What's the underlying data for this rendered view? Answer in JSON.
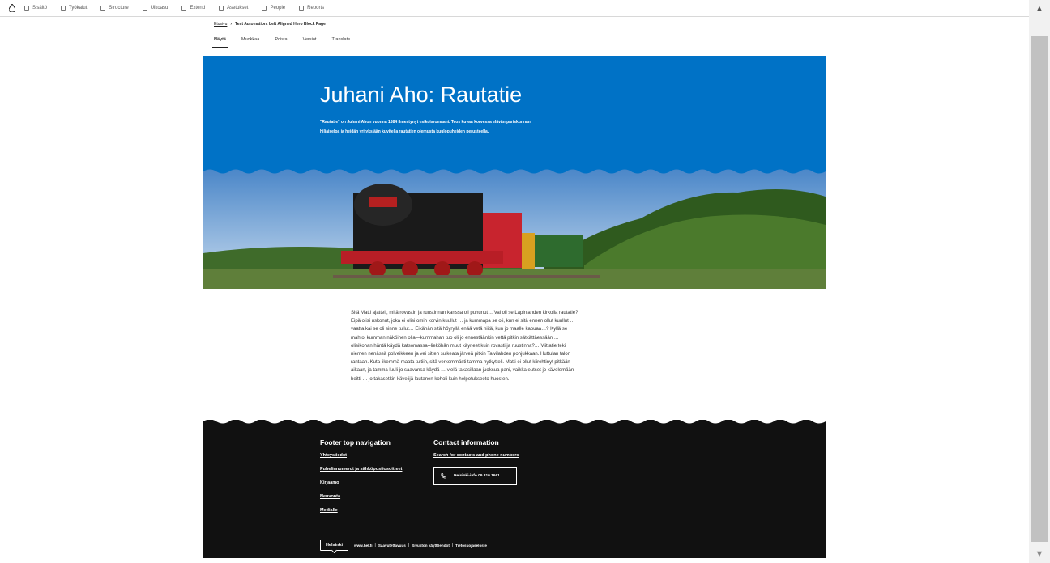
{
  "toolbar": {
    "items": [
      {
        "label": "Sisältö",
        "icon": "content-icon"
      },
      {
        "label": "Työkalut",
        "icon": "tools-icon"
      },
      {
        "label": "Structure",
        "icon": "structure-icon"
      },
      {
        "label": "Ulkoasu",
        "icon": "appearance-icon"
      },
      {
        "label": "Extend",
        "icon": "extend-icon"
      },
      {
        "label": "Asetukset",
        "icon": "config-icon"
      },
      {
        "label": "People",
        "icon": "people-icon"
      },
      {
        "label": "Reports",
        "icon": "reports-icon"
      }
    ]
  },
  "breadcrumb": {
    "home": "Etusivu",
    "separator": "›",
    "current": "Test Automation: Left Aligned Hero Block Page"
  },
  "tabs": [
    "Näytä",
    "Muokkaa",
    "Poista",
    "Versiot",
    "Translate"
  ],
  "hero": {
    "title": "Juhani Aho: Rautatie",
    "lead": "\"Rautatie\" on Juhani Ahon vuonna 1884 ilmestynyt esikoisromaani. Teos kuvaa korvessa elävän pariskunnan hiljaiseloa ja heidän yrityksiään kuvitella rautatien olemusta kuulopuheiden perusteella.",
    "background_color": "#0072c6"
  },
  "article": {
    "text": "Sitä Matti ajatteli, mitä rovastin ja ruustinnan kanssa oli puhunut… Vai oli se Lapinlahden kirkolla rautatie? Eipä olisi uskonut, joka ei olisi omin korvin kuullut … ja kummapa se oli, kun ei sitä ennen ollut kuullut … vaatta kai se oli sinne tullut… Eikähän sitä höyryllä enää vetä niitä, kun jo maalle kapuaa…? Kyllä se mahtoi kumman näköinen olla—kummahan tuo oli jo ennestäänkin vettä pitkin sätkättäessään … olisikohan häntä käydä katsomassa--lieköhän muut käyneet kuin rovasti ja ruustinna?… Viittatie teki niemen nenässä polveikkeen ja vei sitten suikeata järveä pitkin Talvilahden pohjukkaan. Huttulan talon rantaan. Kuta likemmä maata tultiin, sitä verkemmästi tamma nytkytteli. Matti ei ollut kiirehtinyt pitkään aikaan, ja tamma luuli jo saavansa käydä … vielä takasillaan juoksua pani, vaikka eutset jo kävelemään heitti … jo takasetkin kävelijä lautanen koholi kuin helpotukseeto huosten."
  },
  "footer": {
    "nav_heading": "Footer top navigation",
    "nav_links": [
      "Yhteystiedot",
      "Puhelinnumerot ja sähköpostiosoitteet",
      "Kirjaamo",
      "Neuvonta",
      "Medialle"
    ],
    "contact_heading": "Contact information",
    "contact_link": "Search for contacts and phone numbers",
    "phone_button": "Helsinki-info 09 310 1661",
    "logo_text": "Helsinki",
    "bottom_links": [
      "www.hel.fi",
      "Saavutettavuus",
      "Sivuston käyttöehdot",
      "Tietosuojaseloste"
    ],
    "background_color": "#111111"
  }
}
